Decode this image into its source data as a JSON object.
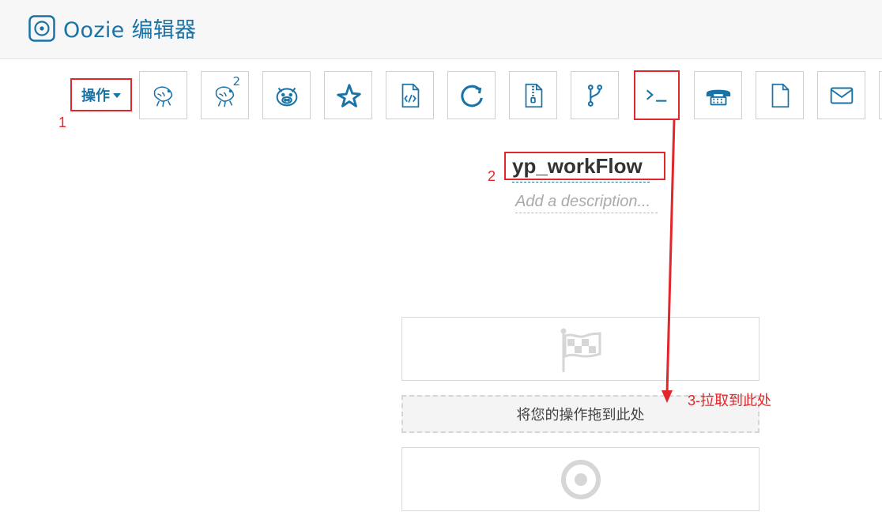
{
  "header": {
    "title": "Oozie 编辑器"
  },
  "toolbar": {
    "actions_label": "操作",
    "tools": [
      {
        "icon": "hive-icon"
      },
      {
        "icon": "hive2-icon",
        "badge": "2"
      },
      {
        "icon": "pig-icon"
      },
      {
        "icon": "spark-icon"
      },
      {
        "icon": "code-file-icon"
      },
      {
        "icon": "sync-icon"
      },
      {
        "icon": "zip-file-icon"
      },
      {
        "icon": "fork-icon"
      },
      {
        "icon": "shell-icon"
      },
      {
        "icon": "ssh-icon"
      },
      {
        "icon": "file-icon"
      },
      {
        "icon": "email-icon"
      }
    ]
  },
  "workflow": {
    "name": "yp_workFlow",
    "description_placeholder": "Add a description..."
  },
  "canvas": {
    "dropzone_text": "将您的操作拖到此处"
  },
  "annotations": {
    "step1": "1",
    "step2": "2",
    "step3": "3-拉取到此处"
  },
  "colors": {
    "accent": "#1a73a6",
    "annotation": "#e3262b"
  }
}
